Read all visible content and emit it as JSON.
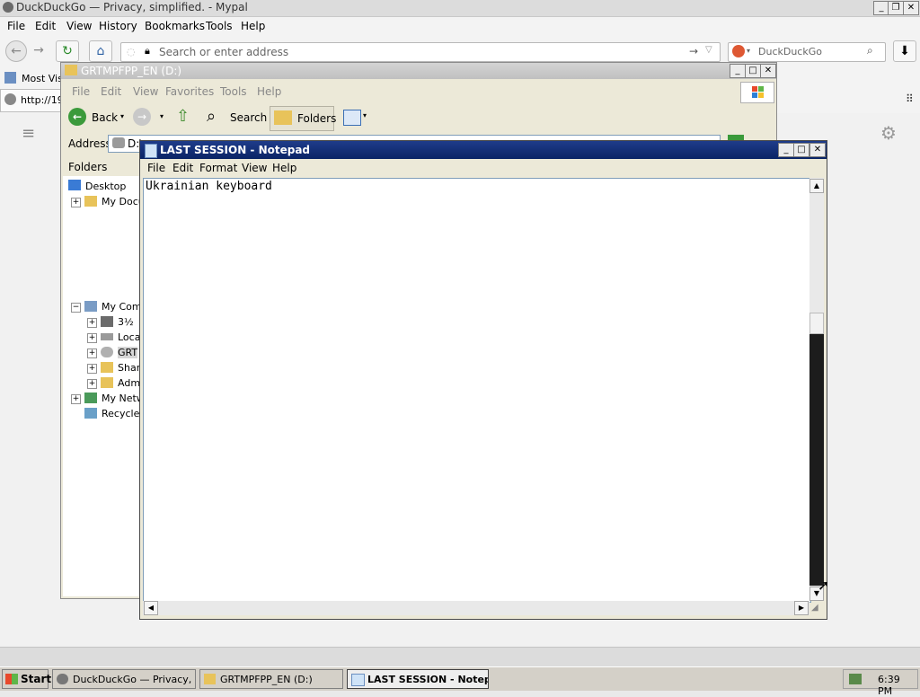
{
  "browser": {
    "title": "DuckDuckGo — Privacy, simplified. - Mypal",
    "menu": [
      "File",
      "Edit",
      "View",
      "History",
      "Bookmarks",
      "Tools",
      "Help"
    ],
    "address_placeholder": "Search or enter address",
    "search_engine": "DuckDuckGo",
    "bookmark": "Most Visi",
    "tab_url": "http://19"
  },
  "explorer": {
    "title": "GRTMPFPP_EN (D:)",
    "menu": [
      "File",
      "Edit",
      "View",
      "Favorites",
      "Tools",
      "Help"
    ],
    "toolbar": {
      "back": "Back",
      "search": "Search",
      "folders": "Folders"
    },
    "address_label": "Address",
    "address_value": "D:\\",
    "folders_header": "Folders",
    "tree": [
      "Desktop",
      "My Docu",
      "My Comp",
      "3½",
      "Loca",
      "GRT",
      "Shar",
      "Adm",
      "My Netw",
      "Recycle"
    ]
  },
  "notepad": {
    "title": "LAST SESSION - Notepad",
    "menu": [
      "File",
      "Edit",
      "Format",
      "View",
      "Help"
    ],
    "content": "Ukrainian keyboard"
  },
  "taskbar": {
    "start": "Start",
    "tasks": [
      "DuckDuckGo — Privacy, ...",
      "GRTMPFPP_EN (D:)",
      "LAST SESSION - Notep..."
    ],
    "clock": "6:39 PM"
  },
  "colors": {
    "notepad_title": "#0a2465",
    "taskbar": "#d4d0c8",
    "explorer_bg": "#ece9d8"
  }
}
